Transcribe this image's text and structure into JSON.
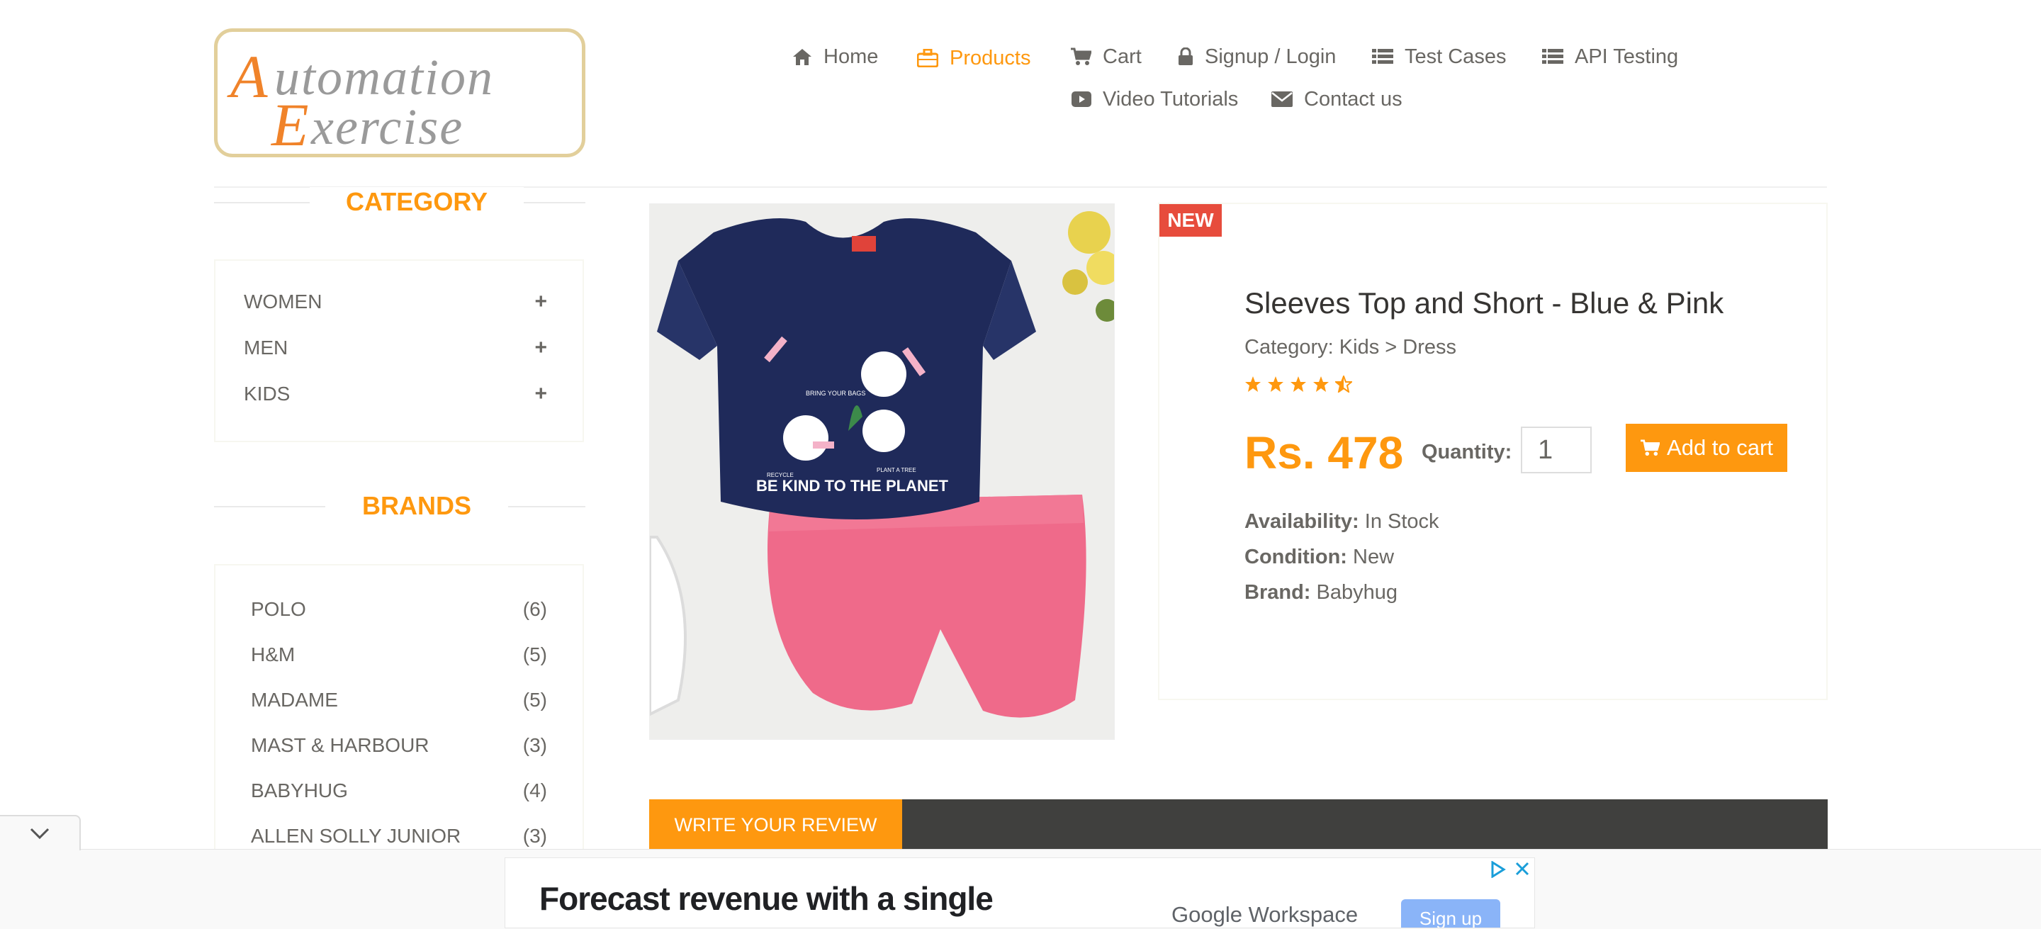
{
  "logo": {
    "line1": "Automation",
    "line2": "Exercise"
  },
  "nav": {
    "home": "Home",
    "products": "Products",
    "cart": "Cart",
    "signup_login": "Signup / Login",
    "test_cases": "Test Cases",
    "api_testing": "API Testing",
    "video_tutorials": "Video Tutorials",
    "contact_us": "Contact us"
  },
  "sidebar": {
    "category_title": "CATEGORY",
    "categories": [
      {
        "label": "WOMEN",
        "toggle": "+"
      },
      {
        "label": "MEN",
        "toggle": "+"
      },
      {
        "label": "KIDS",
        "toggle": "+"
      }
    ],
    "brands_title": "BRANDS",
    "brands": [
      {
        "name": "POLO",
        "count": "(6)"
      },
      {
        "name": "H&M",
        "count": "(5)"
      },
      {
        "name": "MADAME",
        "count": "(5)"
      },
      {
        "name": "MAST & HARBOUR",
        "count": "(3)"
      },
      {
        "name": "BABYHUG",
        "count": "(4)"
      },
      {
        "name": "ALLEN SOLLY JUNIOR",
        "count": "(3)"
      }
    ]
  },
  "product": {
    "badge": "NEW",
    "name": "Sleeves Top and Short - Blue & Pink",
    "category": "Category: Kids > Dress",
    "rating": 4.5,
    "price": "Rs. 478",
    "quantity_label": "Quantity:",
    "quantity_value": "1",
    "add_to_cart": "Add to cart",
    "availability_label": "Availability:",
    "availability_value": " In Stock",
    "condition_label": "Condition:",
    "condition_value": " New",
    "brand_label": "Brand:",
    "brand_value": " Babyhug",
    "image_text": {
      "shirt_slogan": "BE KIND TO THE PLANET",
      "small1": "BRING YOUR BAGS",
      "small2": "RECYCLE",
      "small3": "PLANT A TREE"
    }
  },
  "review": {
    "tab_label": "WRITE YOUR REVIEW"
  },
  "ad": {
    "headline": "Forecast revenue with a single",
    "brand_google": "Google",
    "brand_workspace": "Workspace",
    "signup": "Sign up"
  },
  "colors": {
    "accent": "#FE980F",
    "badge": "#E74C3C",
    "text": "#696763",
    "dark_bar": "#40403E"
  }
}
